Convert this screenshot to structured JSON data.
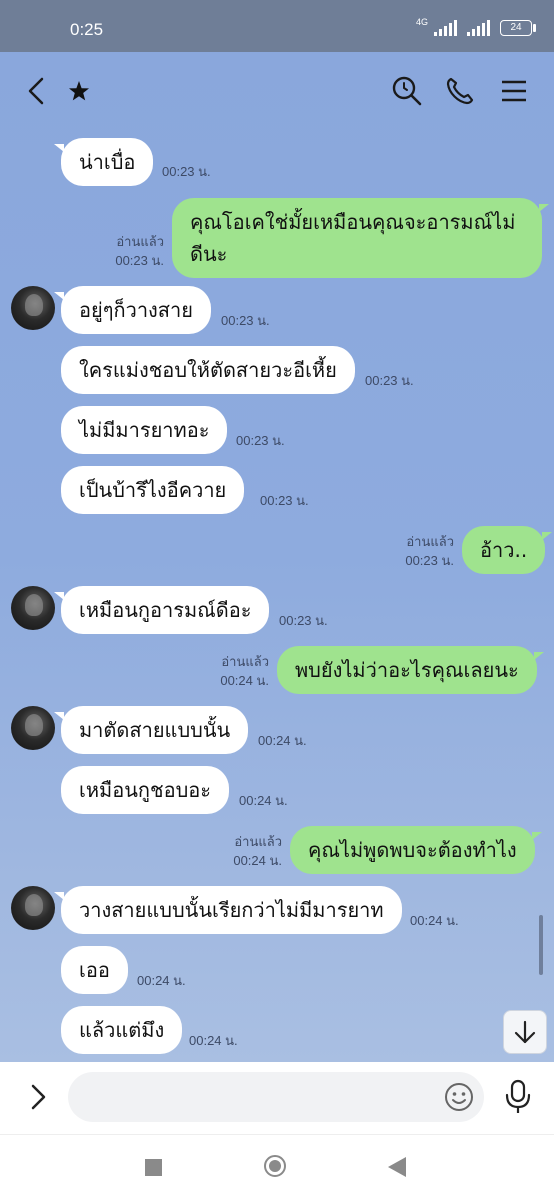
{
  "status_bar": {
    "time": "0:25",
    "network": "4G",
    "battery": "24"
  },
  "header": {
    "icons": [
      "back-icon",
      "star-icon",
      "search-icon",
      "phone-icon",
      "menu-icon"
    ]
  },
  "messages": [
    {
      "side": "in",
      "text": "น่าเบื่อ",
      "time": "00:23 น."
    },
    {
      "side": "out",
      "text": "คุณโอเคใช่มั้ยเหมือนคุณจะอารมณ์ไม่ดีนะ",
      "read": "อ่านแล้ว",
      "time": "00:23 น."
    },
    {
      "side": "in",
      "text": "อยู่ๆก็วางสาย",
      "time": "00:23 น."
    },
    {
      "side": "in",
      "text": "ใครแม่งชอบให้ตัดสายวะอีเหี้ย",
      "time": "00:23 น."
    },
    {
      "side": "in",
      "text": "ไม่มีมารยาทอะ",
      "time": "00:23 น."
    },
    {
      "side": "in",
      "text": "เป็นบ้ารึไงอีควาย",
      "time": "00:23 น."
    },
    {
      "side": "out",
      "text": "อ้าว..",
      "read": "อ่านแล้ว",
      "time": "00:23 น."
    },
    {
      "side": "in",
      "text": "เหมือนกูอารมณ์ดีอะ",
      "time": "00:23 น."
    },
    {
      "side": "out",
      "text": "พบยังไม่ว่าอะไรคุณเลยนะ",
      "read": "อ่านแล้ว",
      "time": "00:24 น."
    },
    {
      "side": "in",
      "text": "มาตัดสายแบบนั้น",
      "time": "00:24 น."
    },
    {
      "side": "in",
      "text": "เหมือนกูชอบอะ",
      "time": "00:24 น."
    },
    {
      "side": "out",
      "text": "คุณไม่พูดพบจะต้องทำไง",
      "read": "อ่านแล้ว",
      "time": "00:24 น."
    },
    {
      "side": "in",
      "text": "วางสายแบบนั้นเรียกว่าไม่มีมารยาท",
      "time": "00:24 น."
    },
    {
      "side": "in",
      "text": "เออ",
      "time": "00:24 น."
    },
    {
      "side": "in",
      "text": "แล้วแต่มึง",
      "time": "00:24 น."
    }
  ],
  "input": {
    "placeholder": "",
    "value": ""
  },
  "colors": {
    "chat_bg": "#8fa9d9",
    "bubble_in": "#ffffff",
    "bubble_out": "#9fe38e",
    "status_bar": "#6f7e97"
  }
}
